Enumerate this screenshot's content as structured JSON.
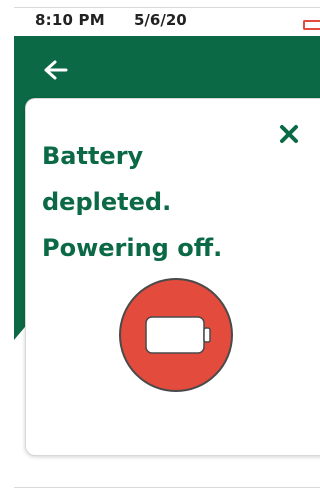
{
  "status_bar": {
    "time": "8:10 PM",
    "date": "5/6/20"
  },
  "header": {
    "back_icon": "arrow-left-icon"
  },
  "dialog": {
    "message_lines": [
      "Battery",
      "depleted.",
      "Powering off."
    ],
    "close_icon": "close-icon",
    "graphic_icon": "battery-empty-icon"
  },
  "colors": {
    "brand_green": "#0b6a45",
    "alert_red": "#e34b3c",
    "text_dark": "#222222"
  }
}
